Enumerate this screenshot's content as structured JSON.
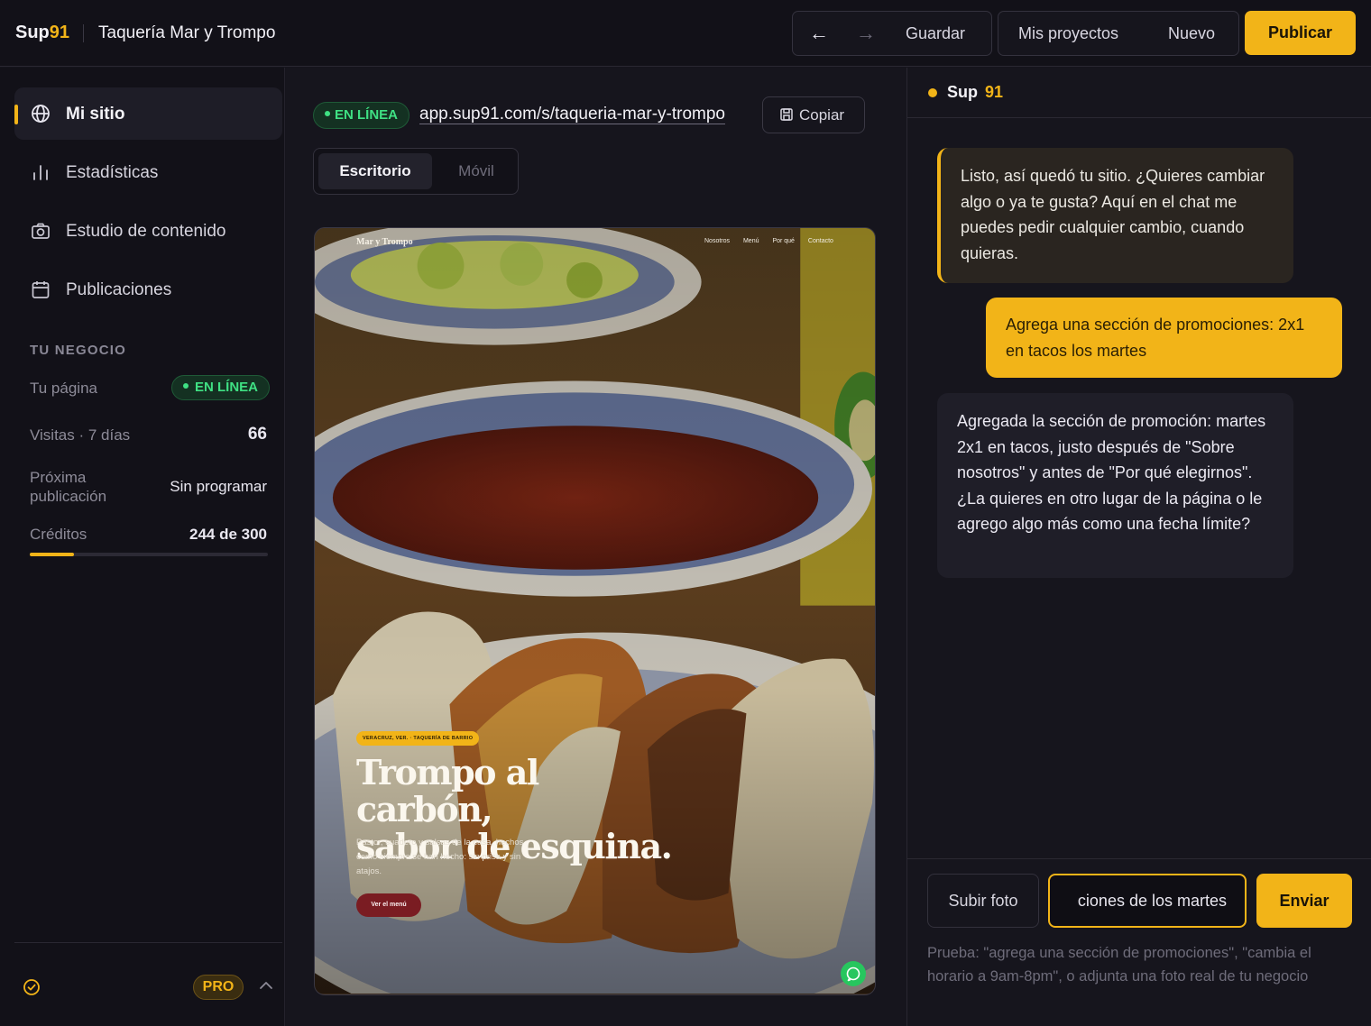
{
  "header": {
    "brand_prefix": "Sup",
    "brand_number": "91",
    "site_name": "Taquería Mar y Trompo",
    "back_symbol": "←",
    "forward_symbol": "→",
    "save_label": "Guardar",
    "projects_label": "Mis proyectos",
    "new_label": "Nuevo",
    "publish_label": "Publicar"
  },
  "sidebar": {
    "items": [
      {
        "label": "Mi sitio",
        "icon": "globe-icon",
        "active": true
      },
      {
        "label": "Estadísticas",
        "icon": "bar-chart-icon",
        "active": false
      },
      {
        "label": "Estudio de contenido",
        "icon": "camera-icon",
        "active": false
      },
      {
        "label": "Publicaciones",
        "icon": "calendar-icon",
        "active": false
      }
    ],
    "section_title": "TU NEGOCIO",
    "page_label": "Tu página",
    "page_status": "EN LÍNEA",
    "visits_label": "Visitas · 7 días",
    "visits_value": "66",
    "next_pub_label": "Próxima publicación",
    "next_pub_value": "Sin programar",
    "credits_label": "Créditos",
    "credits_value": "244 de 300",
    "credits_used_fraction": 0.187,
    "plan_badge": "PRO"
  },
  "center": {
    "status_badge": "EN LÍNEA",
    "url": "app.sup91.com/s/taqueria-mar-y-trompo",
    "copy_label": "Copiar",
    "view_tabs": [
      "Escritorio",
      "Móvil"
    ],
    "active_view": "Escritorio"
  },
  "preview": {
    "brand": "Mar y Trompo",
    "nav_links": [
      "Nosotros",
      "Menú",
      "Por qué",
      "Contacto"
    ],
    "tag": "VERACRUZ, VER. · TAQUERÍA DE BARRIO",
    "title_line1": "Trompo al carbón,",
    "title_line2": "sabor de esquina.",
    "subtitle": "Pastor, suadero y salsas de la casa, hechos como siempre se han hecho: sin prisa y sin atajos.",
    "cta": "Ver el menú"
  },
  "chat": {
    "assistant_name": "Sup",
    "assistant_number": "91",
    "messages": [
      {
        "role": "assistant",
        "text": "Listo, así quedó tu sitio. ¿Quieres cambiar algo o ya te gusta? Aquí en el chat me puedes pedir cualquier cambio, cuando quieras."
      },
      {
        "role": "user",
        "text": "Agrega una sección de promociones: 2x1 en tacos los martes"
      },
      {
        "role": "assistant",
        "text": "Agregada la sección de promoción: martes 2x1 en tacos, justo después de \"Sobre nosotros\" y antes de \"Por qué elegirnos\". ¿La quieres en otro lugar de la página o le agrego algo más como una fecha límite?"
      }
    ],
    "upload_label": "Subir foto",
    "input_value": "ciones de los martes",
    "send_label": "Enviar",
    "hint": "Prueba: \"agrega una sección de promociones\", \"cambia el horario a 9am-8pm\", o adjunta una foto real de tu negocio"
  },
  "colors": {
    "accent": "#f2b418",
    "online": "#3fe083",
    "background": "#15141c"
  }
}
